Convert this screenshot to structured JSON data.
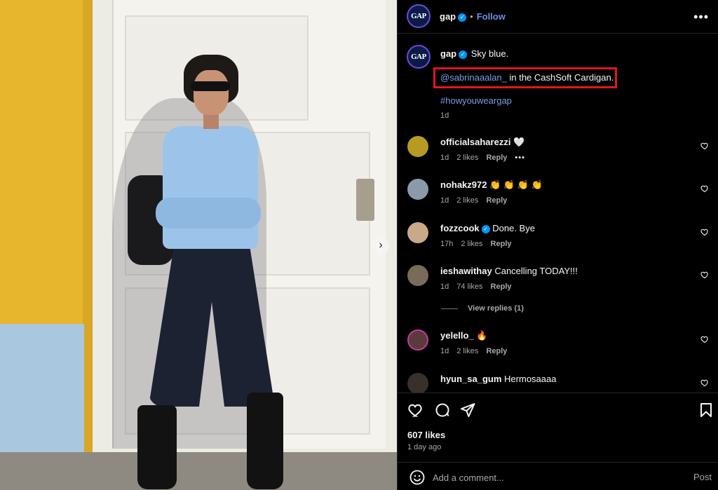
{
  "header": {
    "username": "gap",
    "separator": "•",
    "follow_label": "Follow",
    "avatar_text": "GAP",
    "more_icon": "ellipsis-horizontal-icon"
  },
  "caption": {
    "username": "gap",
    "text": "Sky blue.",
    "mention": "@sabrinaaalan_",
    "mention_rest": " in the CashSoft Cardigan.",
    "hashtag": "#howyouweargap",
    "time": "1d"
  },
  "comments": [
    {
      "username": "officialsaharezzi",
      "text": "🤍",
      "time": "1d",
      "likes": "2 likes",
      "reply": "Reply",
      "more": "•••",
      "avatar_color": "#b79a22"
    },
    {
      "username": "nohakz972",
      "text": "👏 👏 👏 👏",
      "time": "1d",
      "likes": "2 likes",
      "reply": "Reply",
      "avatar_color": "#8a9aa8"
    },
    {
      "username": "fozzcook",
      "text": "Done. Bye",
      "time": "17h",
      "likes": "2 likes",
      "reply": "Reply",
      "avatar_color": "#c9a98a"
    },
    {
      "username": "ieshawithay",
      "text": "Cancelling TODAY!!!",
      "time": "1d",
      "likes": "74 likes",
      "reply": "Reply",
      "avatar_color": "#7a6a5a"
    },
    {
      "username": "yelello_",
      "text": "🔥",
      "time": "1d",
      "likes": "2 likes",
      "reply": "Reply",
      "avatar_color": "#5a3a3a"
    },
    {
      "username": "hyun_sa_gum",
      "text": "Hermosaaaa",
      "avatar_color": "#3a302a"
    }
  ],
  "view_replies": "View replies (1)",
  "actions": {
    "likes": "607 likes",
    "ago": "1 day ago",
    "add_comment_placeholder": "Add a comment...",
    "post_label": "Post"
  },
  "colors": {
    "background": "#000000",
    "text": "#f5f5f5",
    "muted": "#a8a8a8",
    "link": "#7a9de8",
    "verified": "#0095f6",
    "highlight": "#e0161c"
  }
}
